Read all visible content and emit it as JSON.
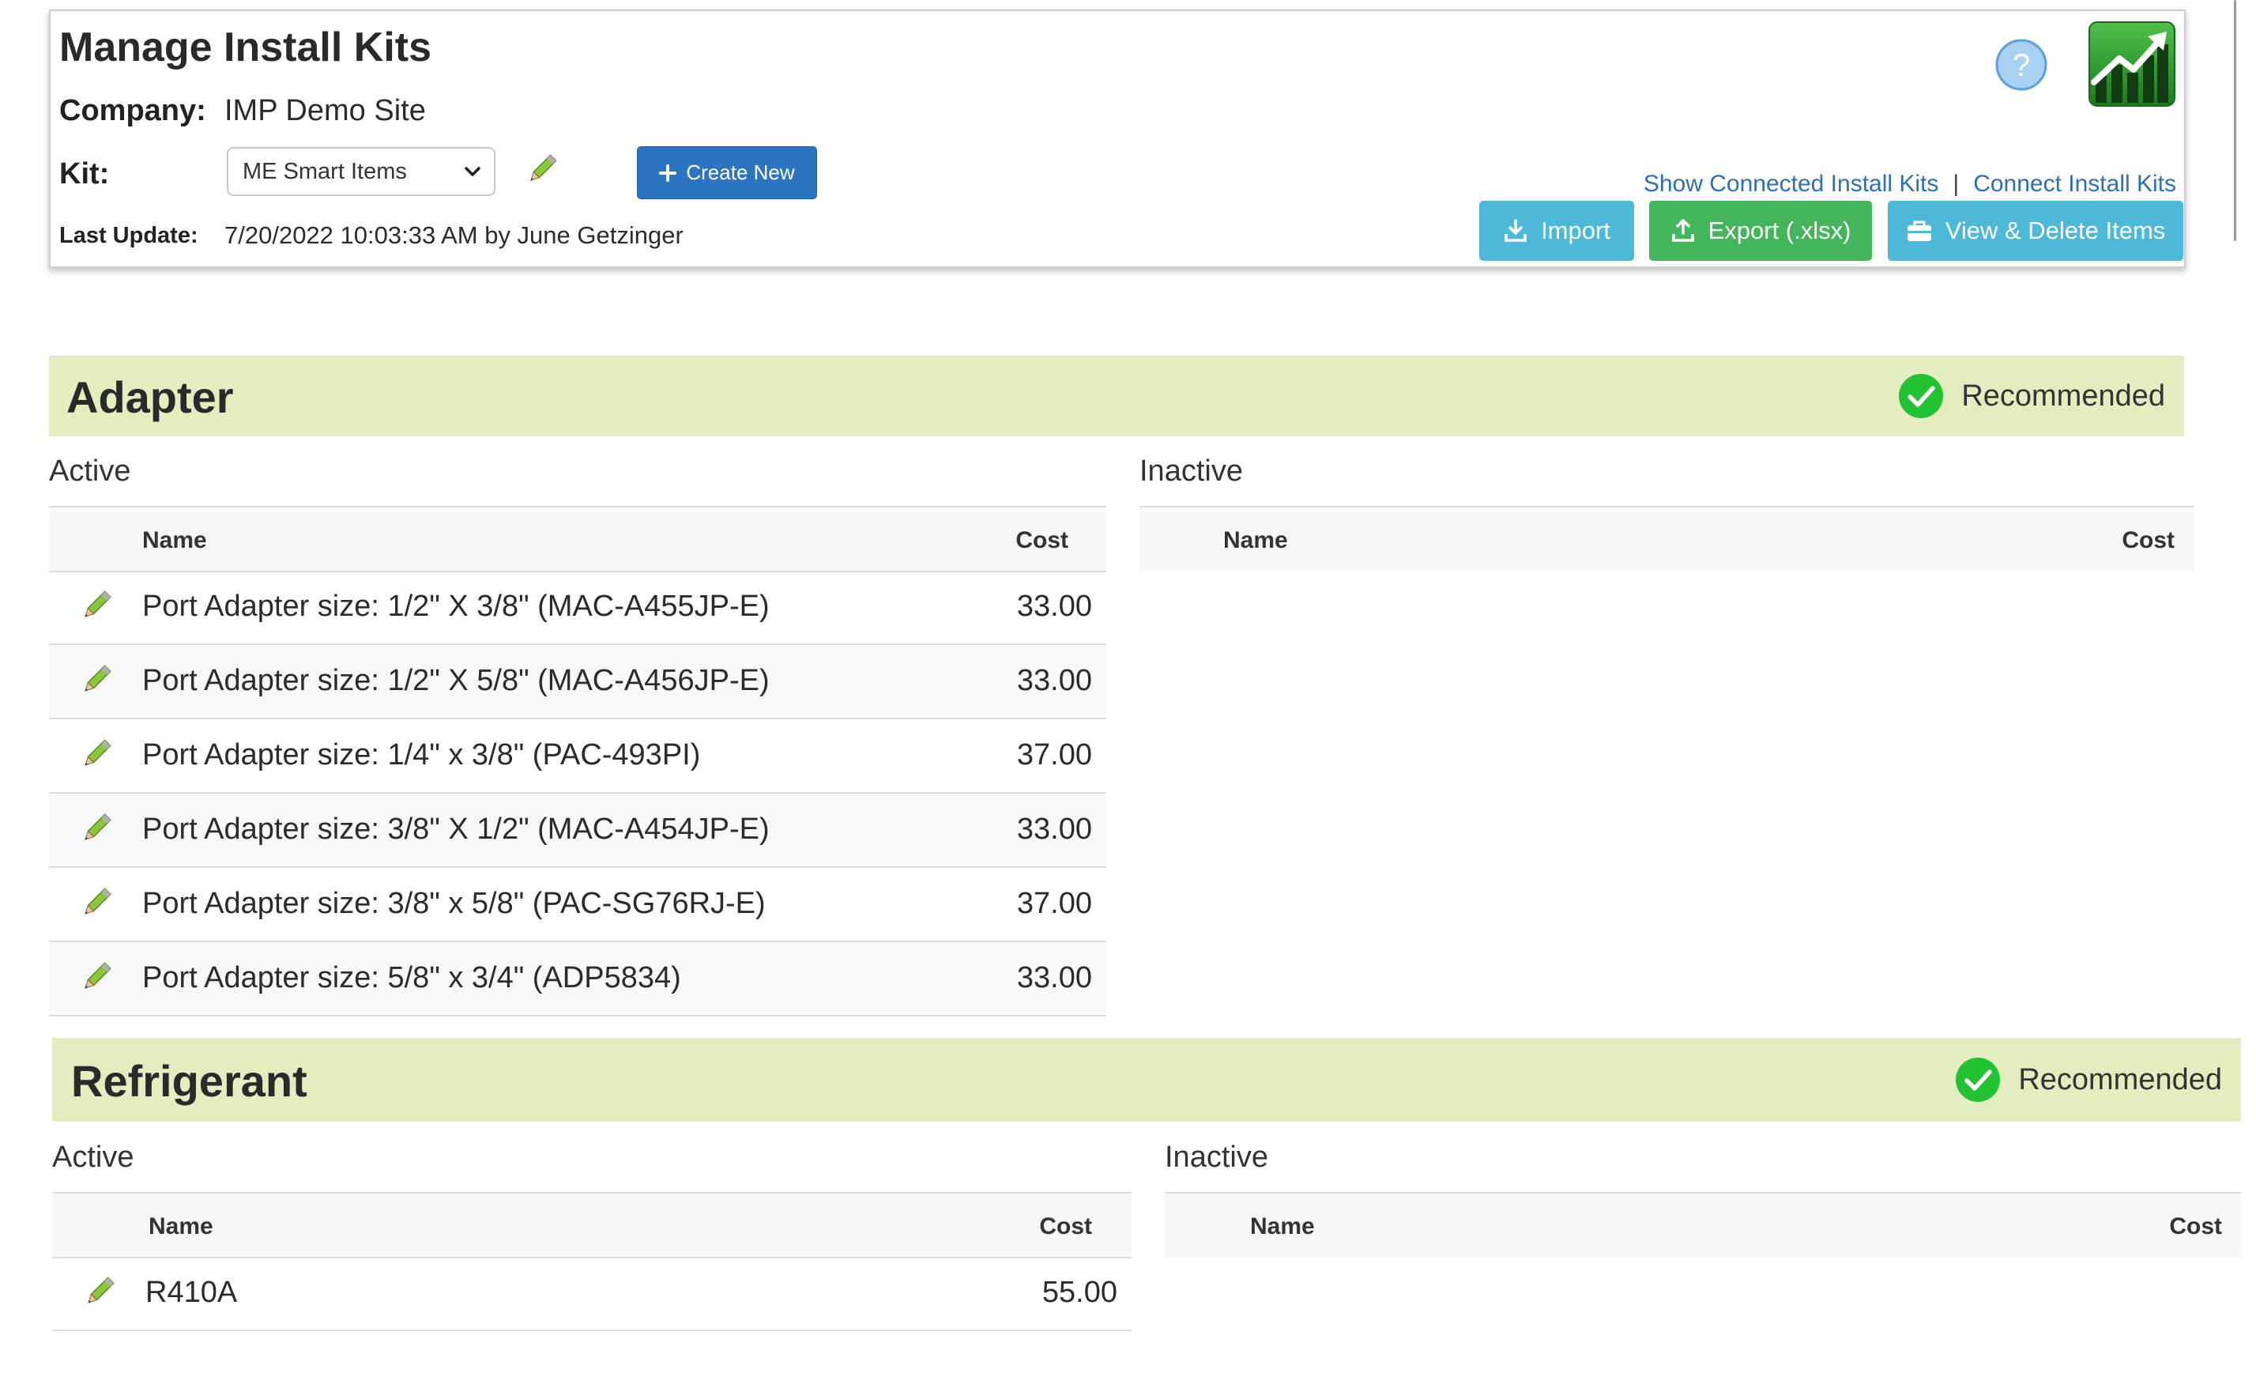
{
  "header": {
    "title": "Manage Install Kits",
    "company_label": "Company:",
    "company_value": "IMP Demo Site",
    "kit_label": "Kit:",
    "kit_selected": "ME Smart Items",
    "create_new_label": "Create New",
    "last_update_label": "Last Update:",
    "last_update_value": "7/20/2022 10:03:33 AM by June Getzinger",
    "help_icon": "question-circle-icon",
    "logo_icon": "trend-chart-logo",
    "links": {
      "show_connected": "Show Connected Install Kits",
      "separator": "|",
      "connect": "Connect Install Kits"
    },
    "buttons": {
      "import": "Import",
      "export": "Export (.xlsx)",
      "view_delete": "View & Delete Items"
    }
  },
  "colors": {
    "primary_blue": "#2c74c0",
    "info_blue": "#4db8d8",
    "success_green": "#44b55b",
    "section_bg": "#e2edc0",
    "check_green": "#22c232",
    "link_blue": "#2e6fb0"
  },
  "sections": [
    {
      "title": "Adapter",
      "status": "Recommended",
      "active_label": "Active",
      "inactive_label": "Inactive",
      "columns": {
        "name": "Name",
        "cost": "Cost"
      },
      "active_rows": [
        {
          "name": "Port Adapter size: 1/2\" X 3/8\" (MAC-A455JP-E)",
          "cost": "33.00"
        },
        {
          "name": "Port Adapter size: 1/2\" X 5/8\" (MAC-A456JP-E)",
          "cost": "33.00"
        },
        {
          "name": "Port Adapter size: 1/4\" x 3/8\" (PAC-493PI)",
          "cost": "37.00"
        },
        {
          "name": "Port Adapter size: 3/8\" X 1/2\" (MAC-A454JP-E)",
          "cost": "33.00"
        },
        {
          "name": "Port Adapter size: 3/8\" x 5/8\" (PAC-SG76RJ-E)",
          "cost": "37.00"
        },
        {
          "name": "Port Adapter size: 5/8\" x 3/4\" (ADP5834)",
          "cost": "33.00"
        }
      ],
      "inactive_rows": []
    },
    {
      "title": "Refrigerant",
      "status": "Recommended",
      "active_label": "Active",
      "inactive_label": "Inactive",
      "columns": {
        "name": "Name",
        "cost": "Cost"
      },
      "active_rows": [
        {
          "name": "R410A",
          "cost": "55.00"
        }
      ],
      "inactive_rows": []
    }
  ]
}
